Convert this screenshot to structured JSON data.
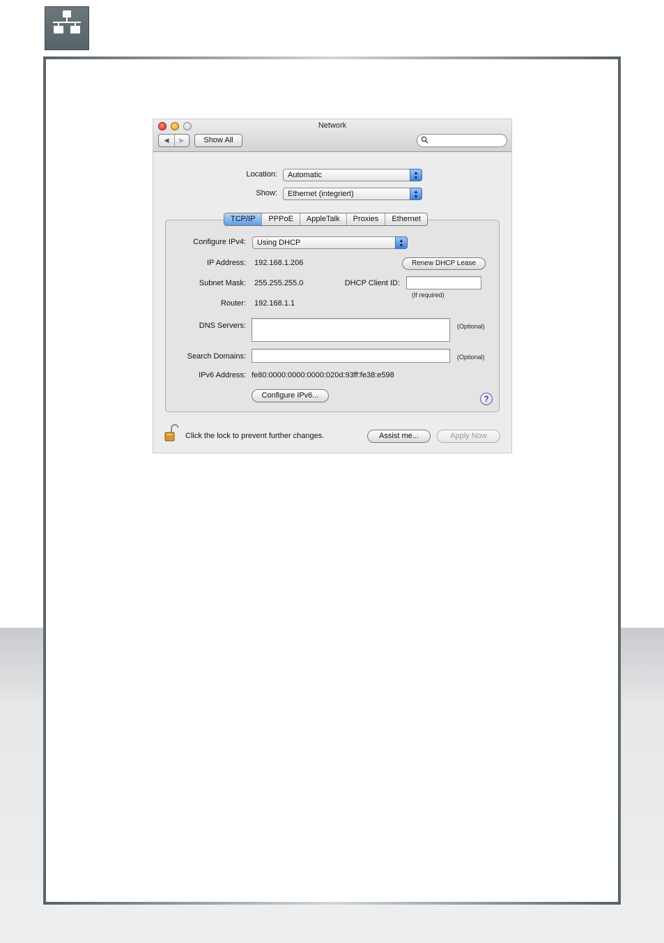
{
  "window": {
    "title": "Network",
    "toolbar": {
      "back_glyph": "◀",
      "forward_glyph": "▶",
      "show_all_label": "Show All",
      "search_placeholder": ""
    }
  },
  "location": {
    "label": "Location:",
    "value": "Automatic"
  },
  "show": {
    "label": "Show:",
    "value": "Ethernet (integriert)"
  },
  "tabs": [
    {
      "label": "TCP/IP",
      "active": true
    },
    {
      "label": "PPPoE",
      "active": false
    },
    {
      "label": "AppleTalk",
      "active": false
    },
    {
      "label": "Proxies",
      "active": false
    },
    {
      "label": "Ethernet",
      "active": false
    }
  ],
  "tcpip": {
    "configure_label": "Configure IPv4:",
    "configure_value": "Using DHCP",
    "ip_label": "IP Address:",
    "ip_value": "192.168.1.206",
    "renew_button": "Renew DHCP Lease",
    "subnet_label": "Subnet Mask:",
    "subnet_value": "255.255.255.0",
    "client_id_label": "DHCP Client ID:",
    "client_id_value": "",
    "client_id_hint": "(If required)",
    "router_label": "Router:",
    "router_value": "192.168.1.1",
    "dns_label": "DNS Servers:",
    "dns_value": "",
    "dns_hint": "(Optional)",
    "search_label": "Search Domains:",
    "search_value": "",
    "search_hint": "(Optional)",
    "ipv6_label": "IPv6 Address:",
    "ipv6_value": "fe80:0000:0000:0000:020d:93ff:fe38:e598",
    "configure_ipv6_button": "Configure IPv6...",
    "help_glyph": "?"
  },
  "footer": {
    "lock_text": "Click the lock to prevent further changes.",
    "assist_button": "Assist me...",
    "apply_button": "Apply Now"
  },
  "colors": {
    "frame_border": "#5d686e",
    "active_tab": "#5d9be6",
    "icon_tile": "#5f6b72"
  },
  "icons": [
    "network-icon",
    "search-icon",
    "lock-icon",
    "help-icon"
  ]
}
